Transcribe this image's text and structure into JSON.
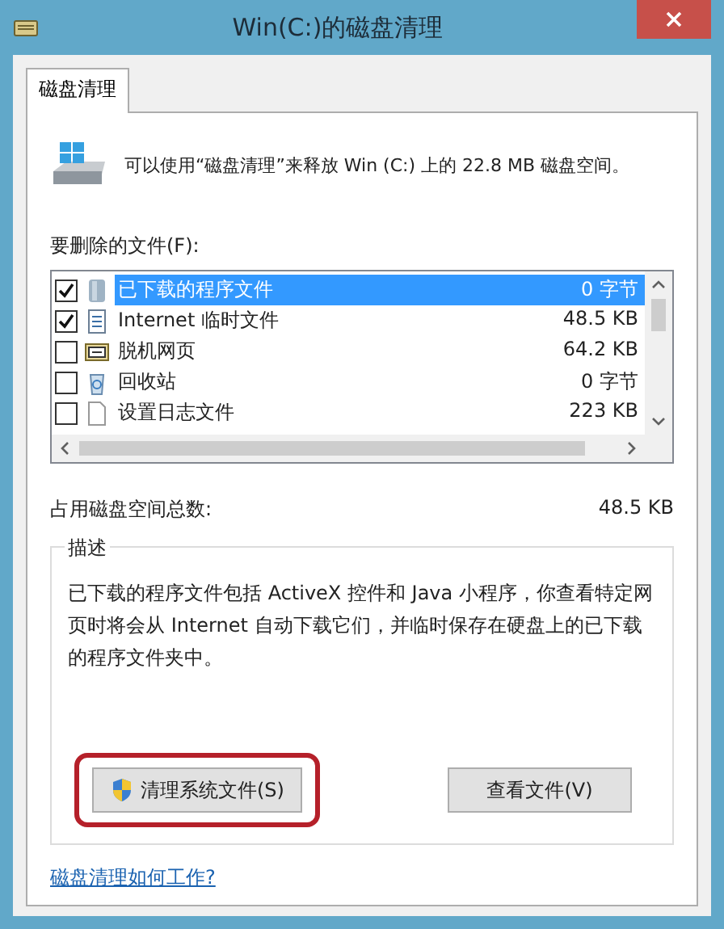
{
  "window": {
    "title": "Win(C:)的磁盘清理"
  },
  "tabs": [
    {
      "label": "磁盘清理",
      "selected": true
    }
  ],
  "intro": "可以使用“磁盘清理”来释放 Win (C:) 上的 22.8 MB 磁盘空间。",
  "files_label": "要删除的文件(F):",
  "files": [
    {
      "name": "已下载的程序文件",
      "size": "0 字节",
      "checked": true,
      "selected": true,
      "kind": "folder"
    },
    {
      "name": "Internet 临时文件",
      "size": "48.5 KB",
      "checked": true,
      "selected": false,
      "kind": "doc"
    },
    {
      "name": "脱机网页",
      "size": "64.2 KB",
      "checked": false,
      "selected": false,
      "kind": "web"
    },
    {
      "name": "回收站",
      "size": "0 字节",
      "checked": false,
      "selected": false,
      "kind": "bin"
    },
    {
      "name": "设置日志文件",
      "size": "223 KB",
      "checked": false,
      "selected": false,
      "kind": "page"
    }
  ],
  "total": {
    "label": "占用磁盘空间总数:",
    "value": "48.5 KB"
  },
  "description": {
    "title": "描述",
    "text": "已下载的程序文件包括 ActiveX 控件和 Java 小程序，你查看特定网页时将会从 Internet 自动下载它们，并临时保存在硬盘上的已下载的程序文件夹中。"
  },
  "buttons": [
    {
      "label": "清理系统文件(S)",
      "kind": "shield",
      "highlighted": true
    },
    {
      "label": "查看文件(V)",
      "kind": "plain",
      "highlighted": false
    }
  ],
  "help_link": "磁盘清理如何工作?"
}
